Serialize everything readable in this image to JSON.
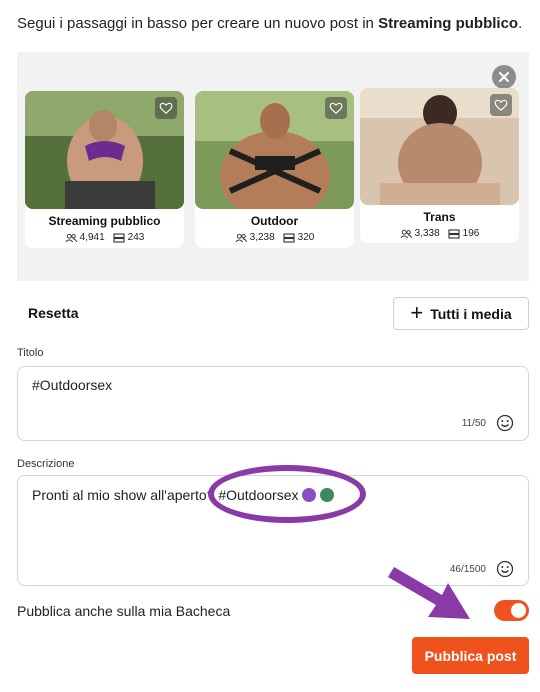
{
  "intro": {
    "text_before": "Segui i passaggi in basso per creare un nuovo post in ",
    "channel": "Streaming pubblico",
    "text_after": "."
  },
  "cards": [
    {
      "name": "Streaming pubblico",
      "followers": "4,941",
      "posts": "243"
    },
    {
      "name": "Outdoor",
      "followers": "3,238",
      "posts": "320"
    },
    {
      "name": "Trans",
      "followers": "3,338",
      "posts": "196"
    }
  ],
  "actions": {
    "reset_label": "Resetta",
    "all_media_label": "Tutti i media",
    "all_media_icon": "plus-icon"
  },
  "title_field": {
    "label": "Titolo",
    "value": "#Outdoorsex",
    "counter": "11/50"
  },
  "description_field": {
    "label": "Descrizione",
    "value": "Pronti al mio show all'aperto? #Outdoorsex",
    "counter": "46/1500"
  },
  "wall": {
    "label": "Pubblica anche sulla mia Bacheca",
    "enabled": true
  },
  "publish_label": "Pubblica post",
  "colors": {
    "accent": "#f0521e",
    "annotation": "#8a3aa6"
  }
}
